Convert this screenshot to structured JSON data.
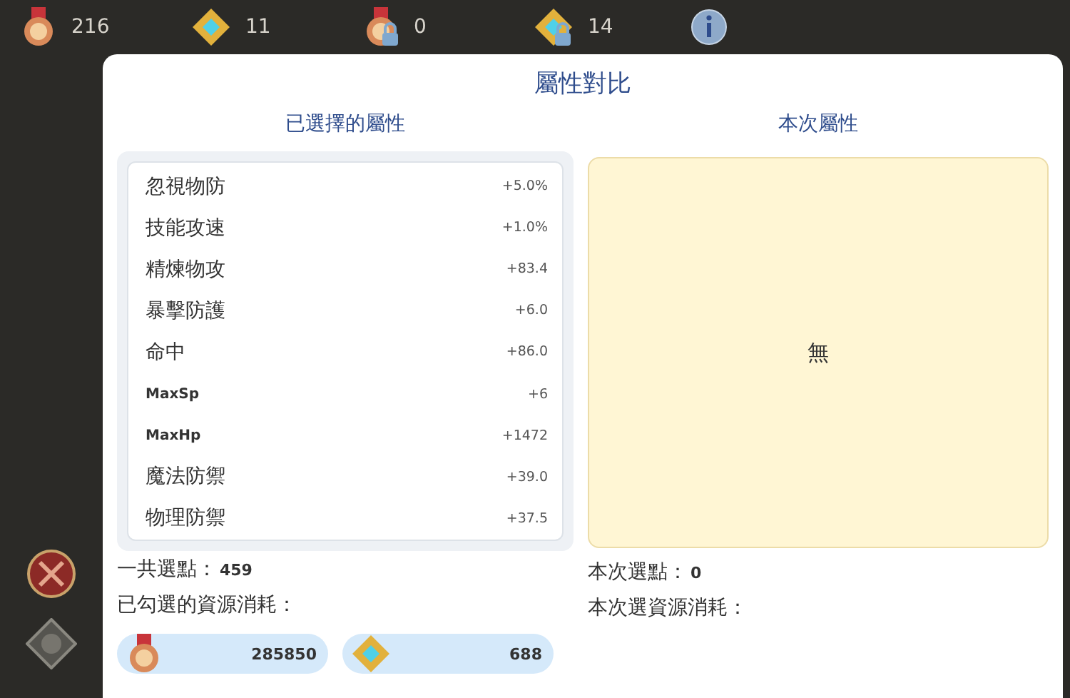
{
  "top_bar": [
    {
      "kind": "medal",
      "value": "216",
      "locked": false
    },
    {
      "kind": "crystal",
      "value": "11",
      "locked": false
    },
    {
      "kind": "medal",
      "value": "0",
      "locked": true
    },
    {
      "kind": "crystal",
      "value": "14",
      "locked": true
    }
  ],
  "dialog": {
    "title": "屬性對比",
    "left": {
      "header": "已選擇的屬性",
      "attributes": [
        {
          "name": "忽視物防",
          "value": "+5.0%"
        },
        {
          "name": "技能攻速",
          "value": "+1.0%"
        },
        {
          "name": "精煉物攻",
          "value": "+83.4"
        },
        {
          "name": "暴擊防護",
          "value": "+6.0"
        },
        {
          "name": "命中",
          "value": "+86.0"
        },
        {
          "name": "MaxSp",
          "value": "+6"
        },
        {
          "name": "MaxHp",
          "value": "+1472"
        },
        {
          "name": "魔法防禦",
          "value": "+39.0"
        },
        {
          "name": "物理防禦",
          "value": "+37.5"
        }
      ],
      "points_label": "一共選點：",
      "points": "459",
      "cost_label": "已勾選的資源消耗：",
      "costs": [
        {
          "kind": "medal",
          "value": "285850"
        },
        {
          "kind": "crystal",
          "value": "688"
        }
      ]
    },
    "right": {
      "header": "本次屬性",
      "empty_text": "無",
      "points_label": "本次選點：",
      "points": "0",
      "cost_label": "本次選資源消耗："
    }
  }
}
